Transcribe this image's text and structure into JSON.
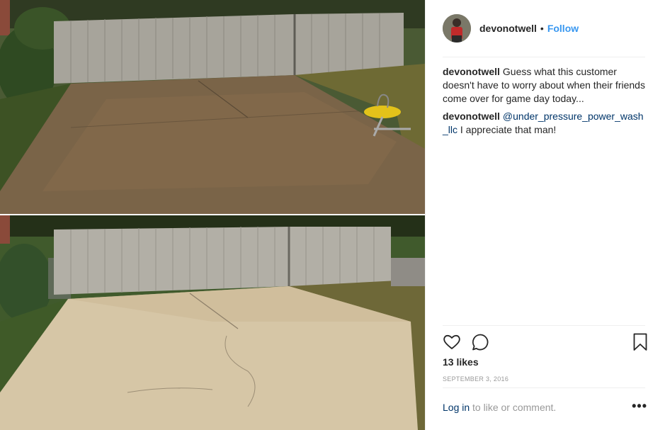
{
  "post": {
    "username": "devonotwell",
    "separator": "•",
    "follow_label": "Follow"
  },
  "comments": [
    {
      "user": "devonotwell",
      "text": "Guess what this customer doesn't have to worry about when their friends come over for game day today..."
    },
    {
      "user": "devonotwell",
      "mention": "@under_pressure_power_wash_llc",
      "text": " I appreciate that man!"
    }
  ],
  "stats": {
    "likes": "13 likes",
    "date": "SEPTEMBER 3, 2016"
  },
  "footer": {
    "login_label": "Log in",
    "suffix": " to like or comment.",
    "more_label": "•••"
  },
  "icons": {
    "like": "heart-icon",
    "comment": "comment-icon",
    "save": "bookmark-icon",
    "more": "more-options-icon"
  },
  "colors": {
    "follow": "#3897f0",
    "link": "#003569",
    "text": "#262626",
    "muted": "#999999"
  }
}
